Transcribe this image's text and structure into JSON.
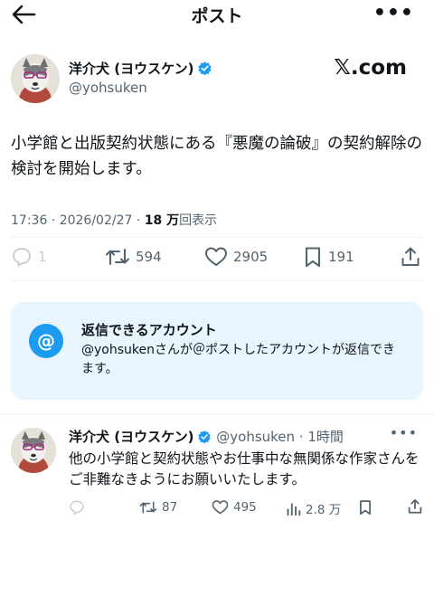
{
  "header": {
    "title": "ポスト"
  },
  "post": {
    "author_name": "洋介犬 (ヨウスケン)",
    "author_handle": "@yohsuken",
    "watermark": "𝕏.com",
    "text": "小学館と出版契約状態にある『悪魔の論破』の契約解除の検討を開始します。",
    "timestamp": "17:36 · 2026/02/27 · ",
    "views_count": "18 万",
    "views_label": "回表示",
    "replies": "1",
    "reposts": "594",
    "likes": "2905",
    "bookmarks": "191"
  },
  "reply_notice": {
    "title": "返信できるアカウント",
    "description": "@yohsukenさんが＠ポストしたアカウントが返信できます。"
  },
  "reply": {
    "author_name": "洋介犬 (ヨウスケン)",
    "handle_time": "@yohsuken · 1時間",
    "text": "他の小学館と契約状態やお仕事中な無関係な作家さんをご非難なきようにお願いいたします。",
    "reposts": "87",
    "likes": "495",
    "views": "2.8 万"
  },
  "colors": {
    "accent": "#1d9bf0",
    "muted": "#536471",
    "notice_bg": "#e8f5fd"
  },
  "icons": [
    "back-arrow-icon",
    "more-icon",
    "verified-icon",
    "reply-icon",
    "repost-icon",
    "like-icon",
    "bookmark-icon",
    "share-icon",
    "views-icon",
    "at-icon"
  ]
}
